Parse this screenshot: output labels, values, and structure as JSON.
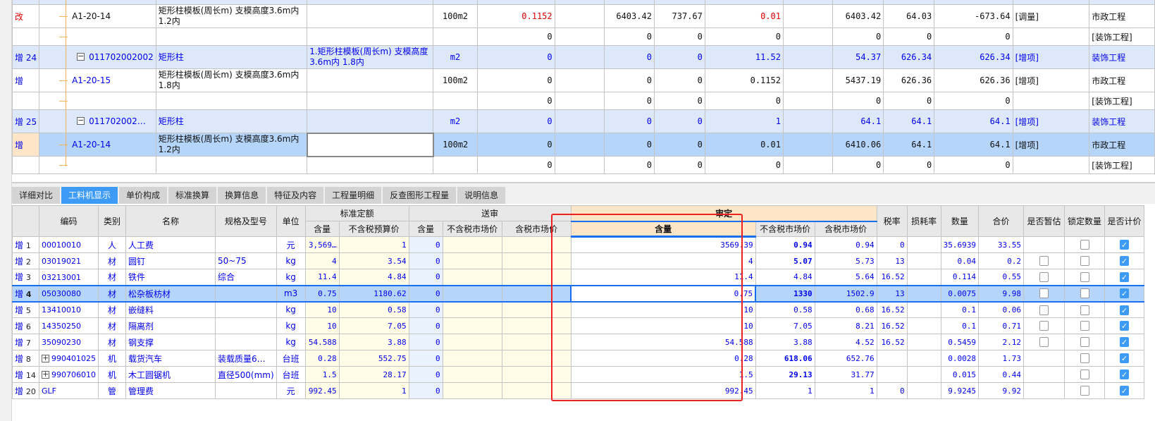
{
  "colors": {
    "accent": "#3d9bf5",
    "group_row": "#dde9fb",
    "selected_row": "#b5d5fb",
    "highlight_box": "#ee2020",
    "audit_header": "#fde5c8"
  },
  "top_rows": [
    {
      "kind": "sub",
      "mark": "改",
      "mark_color": "red",
      "code": "A1-20-14",
      "code_color": "black",
      "name": "矩形柱模板(周长m) 支模高度3.6m内 1.2内",
      "desc": "",
      "unit": "100m2",
      "c6": "0.1152",
      "c6_red": true,
      "c7": "",
      "c8": "6403.42",
      "c9": "737.67",
      "c10": "0.01",
      "c10_red": true,
      "c11": "",
      "c12": "6403.42",
      "c13": "64.03",
      "c14": "-673.64",
      "tag": "[调量]",
      "category": "市政工程"
    },
    {
      "kind": "blank",
      "mark": "",
      "code": "",
      "name": "",
      "desc": "",
      "unit": "",
      "c6": "0",
      "c7": "",
      "c8": "0",
      "c9": "0",
      "c10": "0",
      "c11": "",
      "c12": "0",
      "c13": "0",
      "c14": "0",
      "tag": "",
      "category": "[装饰工程]"
    },
    {
      "kind": "group",
      "mark": "增 24",
      "code": "011702002002",
      "name": "矩形柱",
      "desc": "1.矩形柱模板(周长m) 支模高度3.6m内 1.8内",
      "unit": "m2",
      "c6": "0",
      "c7": "",
      "c8": "0",
      "c9": "0",
      "c10": "11.52",
      "c11": "",
      "c12": "54.37",
      "c13": "626.34",
      "c14": "626.34",
      "tag": "[增项]",
      "category": "装饰工程"
    },
    {
      "kind": "sub",
      "mark": "增",
      "mark_color": "blue",
      "code": "A1-20-15",
      "code_color": "blue",
      "name": "矩形柱模板(周长m) 支模高度3.6m内 1.8内",
      "desc": "",
      "unit": "100m2",
      "c6": "0",
      "c7": "",
      "c8": "0",
      "c9": "0",
      "c10": "0.1152",
      "c11": "",
      "c12": "5437.19",
      "c13": "626.36",
      "c14": "626.36",
      "tag": "[增项]",
      "category": "市政工程"
    },
    {
      "kind": "blank",
      "mark": "",
      "code": "",
      "name": "",
      "desc": "",
      "unit": "",
      "c6": "0",
      "c7": "",
      "c8": "0",
      "c9": "0",
      "c10": "0",
      "c11": "",
      "c12": "0",
      "c13": "0",
      "c14": "0",
      "tag": "",
      "category": "[装饰工程]"
    },
    {
      "kind": "group",
      "mark": "增 25",
      "code": "011702002…",
      "name": "矩形柱",
      "desc": "",
      "unit": "m2",
      "c6": "0",
      "c7": "",
      "c8": "0",
      "c9": "0",
      "c10": "1",
      "c11": "",
      "c12": "64.1",
      "c13": "64.1",
      "c14": "64.1",
      "tag": "[增项]",
      "category": "装饰工程"
    },
    {
      "kind": "selected",
      "mark": "增",
      "mark_color": "blue",
      "code": "A1-20-14",
      "code_color": "blue",
      "name": "矩形柱模板(周长m) 支模高度3.6m内 1.2内",
      "desc": "",
      "unit": "100m2",
      "c6": "0",
      "c7": "",
      "c8": "0",
      "c9": "0",
      "c10": "0.01",
      "c11": "",
      "c12": "6410.06",
      "c13": "64.1",
      "c14": "64.1",
      "tag": "[增项]",
      "category": "市政工程"
    },
    {
      "kind": "blank",
      "mark": "",
      "code": "",
      "name": "",
      "desc": "",
      "unit": "",
      "c6": "0",
      "c7": "",
      "c8": "0",
      "c9": "0",
      "c10": "0",
      "c11": "",
      "c12": "0",
      "c13": "0",
      "c14": "0",
      "tag": "",
      "category": "[装饰工程]"
    }
  ],
  "tabs": [
    {
      "label": "详细对比",
      "active": false
    },
    {
      "label": "工料机显示",
      "active": true
    },
    {
      "label": "单价构成",
      "active": false
    },
    {
      "label": "标准换算",
      "active": false
    },
    {
      "label": "换算信息",
      "active": false
    },
    {
      "label": "特征及内容",
      "active": false
    },
    {
      "label": "工程量明细",
      "active": false
    },
    {
      "label": "反查图形工程量",
      "active": false
    },
    {
      "label": "说明信息",
      "active": false
    }
  ],
  "resource_table": {
    "headers": {
      "code": "编码",
      "type": "类别",
      "name": "名称",
      "spec": "规格及型号",
      "unit": "单位",
      "std_group": "标准定额",
      "std_qty": "含量",
      "std_price": "不含税预算价",
      "sub_group": "送审",
      "sub_qty": "含量",
      "sub_mkt": "不含税市场价",
      "sub_tax": "含税市场价",
      "aud_group": "审定",
      "aud_qty": "含量",
      "aud_mkt": "不含税市场价",
      "aud_tax": "含税市场价",
      "tax_rate": "税率",
      "loss_rate": "损耗率",
      "quantity": "数量",
      "total": "合价",
      "is_estimate": "是否暂估",
      "lock_qty": "锁定数量",
      "is_priced": "是否计价"
    },
    "rows": [
      {
        "mark": "增",
        "no": "1",
        "code": "00010010",
        "expand": false,
        "type": "人",
        "name": "人工费",
        "spec": "",
        "unit": "元",
        "std_qty": "3,569…",
        "std_price": "1",
        "sub_qty": "0",
        "sub_mkt": "",
        "sub_tax": "",
        "aud_qty": "3569.39",
        "aud_mkt": "0.94",
        "aud_mkt_bold": true,
        "aud_tax": "0.94",
        "tax_rate": "0",
        "loss_rate": "",
        "quantity": "35.6939",
        "total": "33.55",
        "is_estimate": null,
        "lock_qty": false,
        "is_priced": true
      },
      {
        "mark": "增",
        "no": "2",
        "code": "03019021",
        "expand": false,
        "type": "材",
        "name": "圆钉",
        "spec": "50~75",
        "unit": "kg",
        "std_qty": "4",
        "std_price": "3.54",
        "sub_qty": "0",
        "sub_mkt": "",
        "sub_tax": "",
        "aud_qty": "4",
        "aud_mkt": "5.07",
        "aud_mkt_bold": true,
        "aud_tax": "5.73",
        "tax_rate": "13",
        "loss_rate": "",
        "quantity": "0.04",
        "total": "0.2",
        "is_estimate": false,
        "lock_qty": false,
        "is_priced": true
      },
      {
        "mark": "增",
        "no": "3",
        "code": "03213001",
        "expand": false,
        "type": "材",
        "name": "铁件",
        "spec": "综合",
        "unit": "kg",
        "std_qty": "11.4",
        "std_price": "4.84",
        "sub_qty": "0",
        "sub_mkt": "",
        "sub_tax": "",
        "aud_qty": "11.4",
        "aud_mkt": "4.84",
        "aud_mkt_bold": false,
        "aud_tax": "5.64",
        "tax_rate": "16.52",
        "loss_rate": "",
        "quantity": "0.114",
        "total": "0.55",
        "is_estimate": false,
        "lock_qty": false,
        "is_priced": true
      },
      {
        "mark": "增",
        "no": "4",
        "code": "05030080",
        "expand": false,
        "selected": true,
        "type": "材",
        "name": "松杂板枋材",
        "spec": "",
        "unit": "m3",
        "std_qty": "0.75",
        "std_price": "1180.62",
        "sub_qty": "0",
        "sub_mkt": "",
        "sub_tax": "",
        "aud_qty": "0.75",
        "aud_mkt": "1330",
        "aud_mkt_bold": true,
        "aud_tax": "1502.9",
        "tax_rate": "13",
        "loss_rate": "",
        "quantity": "0.0075",
        "total": "9.98",
        "is_estimate": false,
        "lock_qty": false,
        "is_priced": true
      },
      {
        "mark": "增",
        "no": "5",
        "code": "13410010",
        "expand": false,
        "type": "材",
        "name": "嵌缝料",
        "spec": "",
        "unit": "kg",
        "std_qty": "10",
        "std_price": "0.58",
        "sub_qty": "0",
        "sub_mkt": "",
        "sub_tax": "",
        "aud_qty": "10",
        "aud_mkt": "0.58",
        "aud_mkt_bold": false,
        "aud_tax": "0.68",
        "tax_rate": "16.52",
        "loss_rate": "",
        "quantity": "0.1",
        "total": "0.06",
        "is_estimate": false,
        "lock_qty": false,
        "is_priced": true
      },
      {
        "mark": "增",
        "no": "6",
        "code": "14350250",
        "expand": false,
        "type": "材",
        "name": "隔离剂",
        "spec": "",
        "unit": "kg",
        "std_qty": "10",
        "std_price": "7.05",
        "sub_qty": "0",
        "sub_mkt": "",
        "sub_tax": "",
        "aud_qty": "10",
        "aud_mkt": "7.05",
        "aud_mkt_bold": false,
        "aud_tax": "8.21",
        "tax_rate": "16.52",
        "loss_rate": "",
        "quantity": "0.1",
        "total": "0.71",
        "is_estimate": false,
        "lock_qty": false,
        "is_priced": true
      },
      {
        "mark": "增",
        "no": "7",
        "code": "35090230",
        "expand": false,
        "type": "材",
        "name": "钢支撑",
        "spec": "",
        "unit": "kg",
        "std_qty": "54.588",
        "std_price": "3.88",
        "sub_qty": "0",
        "sub_mkt": "",
        "sub_tax": "",
        "aud_qty": "54.588",
        "aud_mkt": "3.88",
        "aud_mkt_bold": false,
        "aud_tax": "4.52",
        "tax_rate": "16.52",
        "loss_rate": "",
        "quantity": "0.5459",
        "total": "2.12",
        "is_estimate": false,
        "lock_qty": false,
        "is_priced": true
      },
      {
        "mark": "增",
        "no": "8",
        "code": "990401025",
        "expand": true,
        "type": "机",
        "name": "载货汽车",
        "spec": "装载质量6…",
        "unit": "台班",
        "std_qty": "0.28",
        "std_price": "552.75",
        "sub_qty": "0",
        "sub_mkt": "",
        "sub_tax": "",
        "aud_qty": "0.28",
        "aud_mkt": "618.06",
        "aud_mkt_bold": true,
        "aud_tax": "652.76",
        "tax_rate": "",
        "loss_rate": "",
        "quantity": "0.0028",
        "total": "1.73",
        "is_estimate": null,
        "lock_qty": false,
        "is_priced": true
      },
      {
        "mark": "增",
        "no": "14",
        "code": "990706010",
        "expand": true,
        "type": "机",
        "name": "木工圆锯机",
        "spec": "直径500(mm)",
        "unit": "台班",
        "std_qty": "1.5",
        "std_price": "28.17",
        "sub_qty": "0",
        "sub_mkt": "",
        "sub_tax": "",
        "aud_qty": "1.5",
        "aud_mkt": "29.13",
        "aud_mkt_bold": true,
        "aud_tax": "31.77",
        "tax_rate": "",
        "loss_rate": "",
        "quantity": "0.015",
        "total": "0.44",
        "is_estimate": null,
        "lock_qty": false,
        "is_priced": true
      },
      {
        "mark": "增",
        "no": "20",
        "code": "GLF",
        "expand": false,
        "type": "管",
        "name": "管理费",
        "spec": "",
        "unit": "元",
        "std_qty": "992.45",
        "std_price": "1",
        "sub_qty": "0",
        "sub_mkt": "",
        "sub_tax": "",
        "aud_qty": "992.45",
        "aud_mkt": "1",
        "aud_mkt_bold": false,
        "aud_tax": "1",
        "tax_rate": "0",
        "loss_rate": "",
        "quantity": "9.9245",
        "total": "9.92",
        "is_estimate": null,
        "lock_qty": false,
        "is_priced": true
      }
    ]
  }
}
